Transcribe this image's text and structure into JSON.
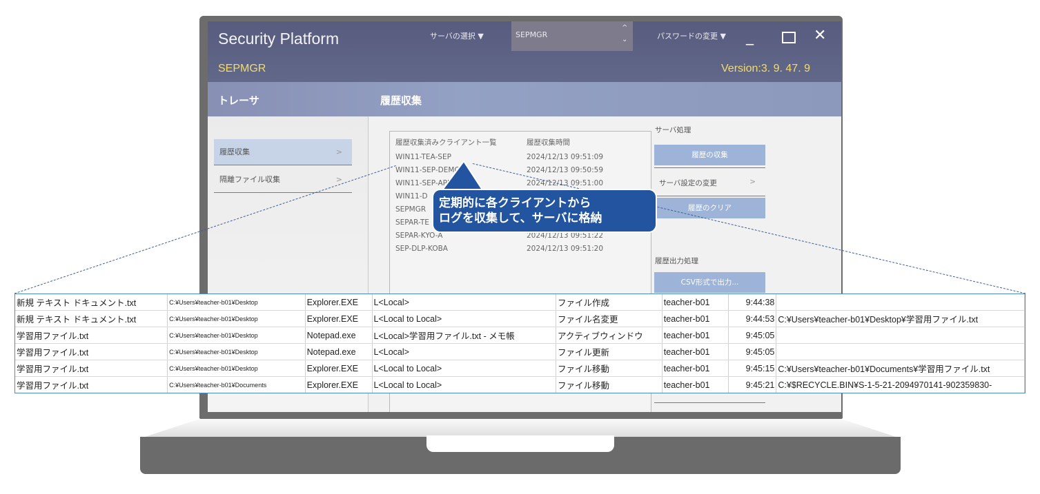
{
  "app": {
    "title": "Security Platform",
    "server_label": "サーバの選択 ▼",
    "server_value": "SEPMGR",
    "password_label": "パスワードの変更 ▼",
    "subtitle_left": "SEPMGR",
    "version": "Version:3. 9. 47. 9"
  },
  "colors": {
    "accent_yellow": "#f6dc63",
    "header": "#5a5f80",
    "button": "#9db3d8",
    "callout": "#23549f"
  },
  "left_panel": {
    "title": "トレーサ",
    "items": [
      {
        "label": "履歴収集",
        "chevron": ">"
      },
      {
        "label": "隔離ファイル収集",
        "chevron": ">"
      }
    ]
  },
  "main": {
    "title": "履歴収集",
    "client_list_header": "履歴収集済みクライアント一覧",
    "time_header": "履歴収集時間",
    "clients": [
      {
        "name": "WIN11-TEA-SEP",
        "time": "2024/12/13 09:51:09"
      },
      {
        "name": "WIN11-SEP-DEMO",
        "time": "2024/12/13 09:50:59"
      },
      {
        "name": "WIN11-SEP-APPR",
        "time": "2024/12/13 09:51:00"
      },
      {
        "name": "WIN11-D",
        "time": ""
      },
      {
        "name": "SEPMGR",
        "time": ""
      },
      {
        "name": "SEPAR-TE",
        "time": ""
      },
      {
        "name": "SEPAR-KYO-A",
        "time": "2024/12/13 09:51:22"
      },
      {
        "name": "SEP-DLP-KOBA",
        "time": "2024/12/13 09:51:20"
      }
    ],
    "server_section": "サーバ処理",
    "collect_button": "履歴の収集",
    "server_settings": "サーバ設定の変更",
    "server_settings_chevron": ">",
    "clear_button": "履歴のクリア",
    "output_section": "履歴出力処理",
    "csv_button": "CSV形式で出力..."
  },
  "callout": {
    "line1": "定期的に各クライアントから",
    "line2": "ログを収集して、サーバに格納"
  },
  "log_rows": [
    [
      "新規 テキスト ドキュメント.txt",
      "C:¥Users¥teacher-b01¥Desktop",
      "Explorer.EXE",
      "L<Local>",
      "ファイル作成",
      "teacher-b01",
      "9:44:38",
      ""
    ],
    [
      "新規 テキスト ドキュメント.txt",
      "C:¥Users¥teacher-b01¥Desktop",
      "Explorer.EXE",
      "L<Local to Local>",
      "ファイル名変更",
      "teacher-b01",
      "9:44:53",
      "C:¥Users¥teacher-b01¥Desktop¥学習用ファイル.txt"
    ],
    [
      "学習用ファイル.txt",
      "C:¥Users¥teacher-b01¥Desktop",
      "Notepad.exe",
      "L<Local>学習用ファイル.txt - メモ帳",
      "アクティブウィンドウ",
      "teacher-b01",
      "9:45:05",
      ""
    ],
    [
      "学習用ファイル.txt",
      "C:¥Users¥teacher-b01¥Desktop",
      "Notepad.exe",
      "L<Local>",
      "ファイル更新",
      "teacher-b01",
      "9:45:05",
      ""
    ],
    [
      "学習用ファイル.txt",
      "C:¥Users¥teacher-b01¥Desktop",
      "Explorer.EXE",
      "L<Local to Local>",
      "ファイル移動",
      "teacher-b01",
      "9:45:15",
      "C:¥Users¥teacher-b01¥Documents¥学習用ファイル.txt"
    ],
    [
      "学習用ファイル.txt",
      "C:¥Users¥teacher-b01¥Documents",
      "Explorer.EXE",
      "L<Local to Local>",
      "ファイル移動",
      "teacher-b01",
      "9:45:21",
      "C:¥$RECYCLE.BIN¥S-1-5-21-2094970141-902359830-"
    ]
  ]
}
